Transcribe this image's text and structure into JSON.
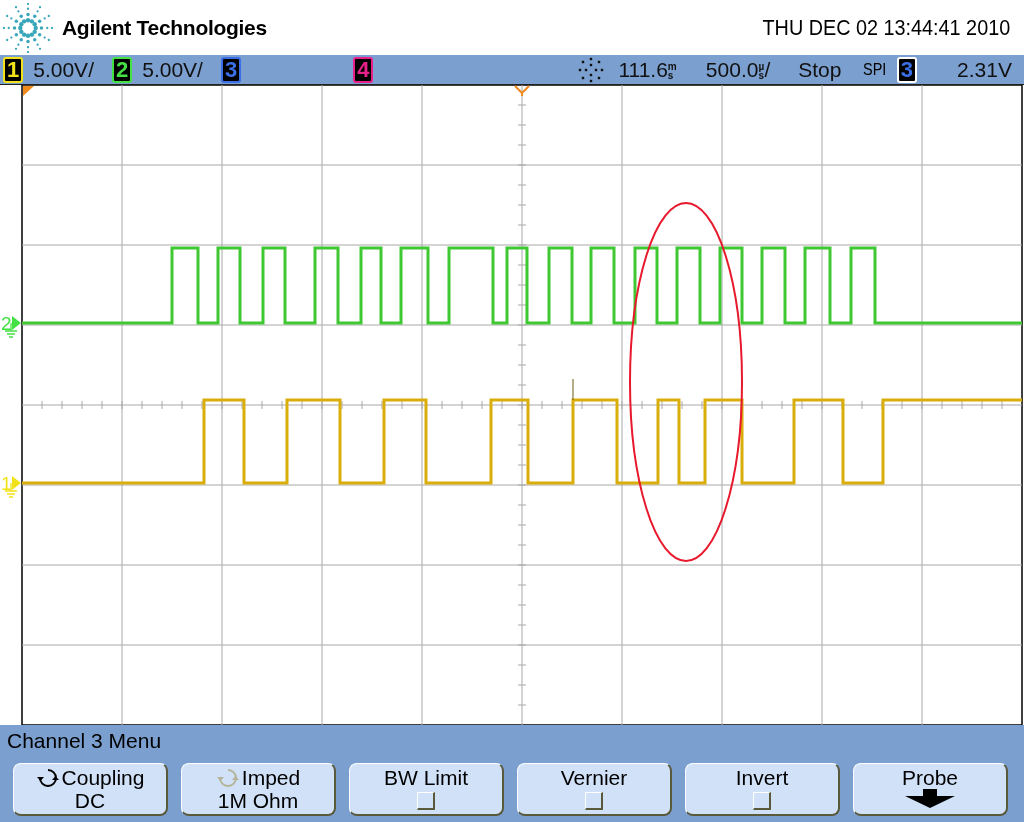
{
  "header": {
    "brand": "Agilent Technologies",
    "datetime": "THU DEC 02 13:44:41 2010"
  },
  "status_bar": {
    "channels": [
      {
        "number": "1",
        "scale": "5.00V/",
        "color": "#f2e21a"
      },
      {
        "number": "2",
        "scale": "5.00V/",
        "color": "#44e044"
      },
      {
        "number": "3",
        "color": "#3b6fe8"
      },
      {
        "number": "4",
        "color": "#e8208a"
      }
    ],
    "delay": {
      "value": "111.6",
      "unit": "ms"
    },
    "timebase": {
      "value": "500.0",
      "unit": "µs",
      "suffix": "/"
    },
    "run_state": "Stop",
    "trigger": {
      "type": "SPI",
      "channel": "3",
      "level": "2.31V"
    }
  },
  "plot": {
    "ground_markers": [
      {
        "label": "2",
        "color": "#44e044"
      },
      {
        "label": "1",
        "color": "#f2e21a"
      }
    ]
  },
  "menu": {
    "title": "Channel 3  Menu",
    "softkeys": [
      {
        "kind": "cycle",
        "label": "Coupling",
        "value": "DC",
        "disabled": false
      },
      {
        "kind": "cycle",
        "label": "Imped",
        "value": "1M Ohm",
        "disabled": true
      },
      {
        "kind": "checkbox",
        "label": "BW Limit",
        "checked": false
      },
      {
        "kind": "checkbox",
        "label": "Vernier",
        "checked": false
      },
      {
        "kind": "checkbox",
        "label": "Invert",
        "checked": false
      },
      {
        "kind": "submenu",
        "label": "Probe"
      }
    ]
  }
}
